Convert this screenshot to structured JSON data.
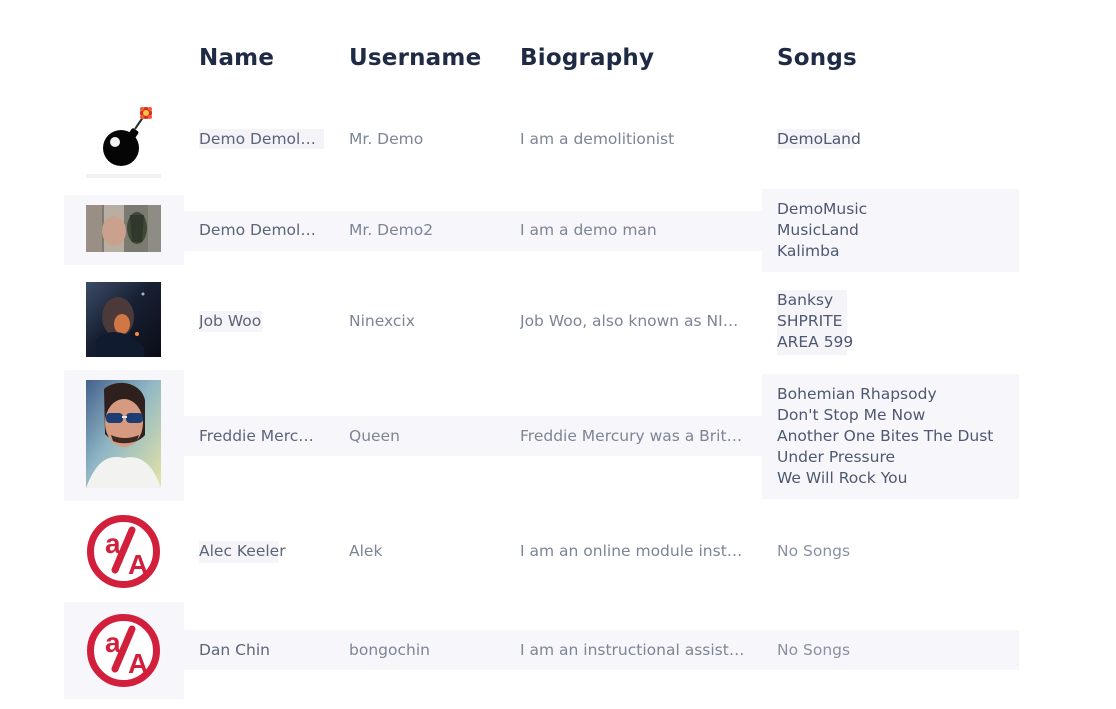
{
  "table": {
    "headers": {
      "name": "Name",
      "username": "Username",
      "biography": "Biography",
      "songs": "Songs"
    },
    "rows": [
      {
        "avatar": "bomb-icon",
        "name": "Demo Demolitionist",
        "username": "Mr. Demo",
        "biography": "I am a demolitionist",
        "songs": [
          "DemoLand"
        ]
      },
      {
        "avatar": "photo-grenade",
        "name": "Demo Demolitionist",
        "username": "Mr. Demo2",
        "biography": "I am a demo man",
        "songs": [
          "DemoMusic",
          "MusicLand",
          "Kalimba"
        ]
      },
      {
        "avatar": "photo-job-woo",
        "name": "Job Woo",
        "username": "Ninexcix",
        "biography": "Job Woo, also known as NINE...",
        "songs": [
          "Banksy",
          "SHPRITE",
          "AREA 599"
        ]
      },
      {
        "avatar": "photo-freddie-mercury",
        "name": "Freddie Mercury",
        "username": "Queen",
        "biography": "Freddie Mercury was a British ...",
        "songs": [
          "Bohemian Rhapsody",
          "Don't Stop Me Now",
          "Another One Bites The Dust",
          "Under Pressure",
          "We Will Rock You"
        ]
      },
      {
        "avatar": "aa-logo",
        "name": "Alec Keeler",
        "username": "Alek",
        "biography": "I am an online module instruc...",
        "songs_text": "No Songs"
      },
      {
        "avatar": "aa-logo",
        "name": "Dan Chin",
        "username": "bongochin",
        "biography": "I am an instructional assistant ...",
        "songs_text": "No Songs"
      }
    ]
  },
  "colors": {
    "header_text": "#1f2a44",
    "body_text": "#5b6478",
    "muted_text": "#7c8496",
    "row_highlight": "#f7f7fb",
    "aa_logo_red": "#d21f3c"
  }
}
